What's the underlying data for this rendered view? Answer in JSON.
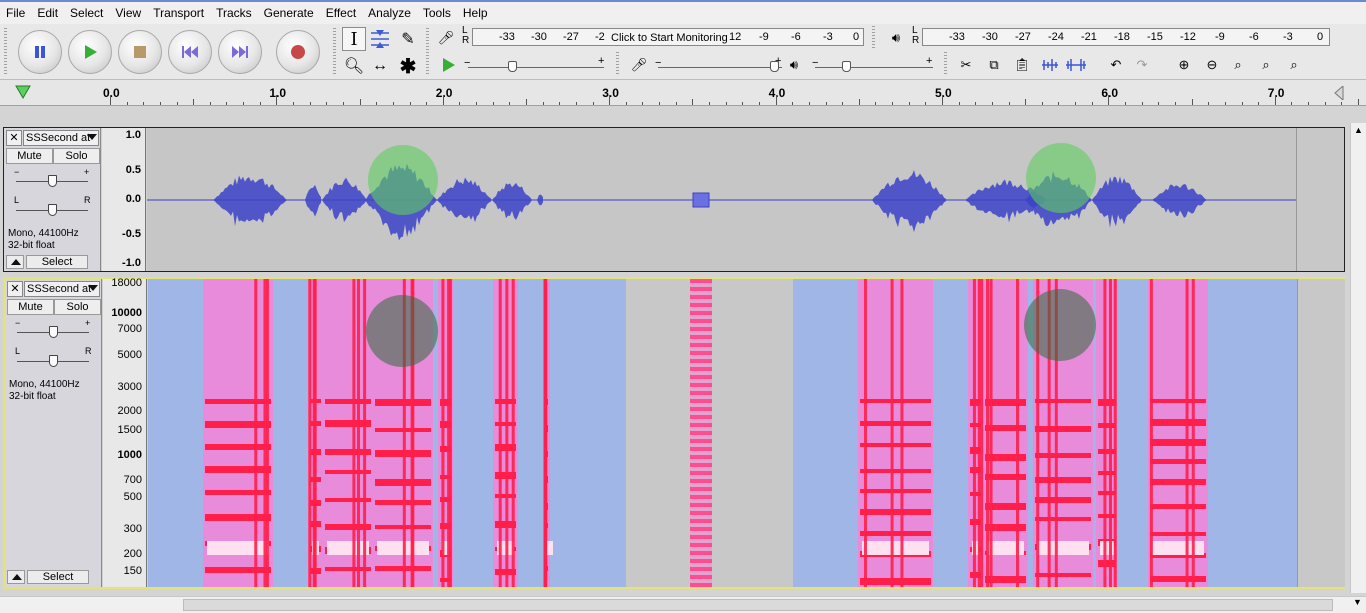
{
  "menu": [
    "File",
    "Edit",
    "Select",
    "View",
    "Transport",
    "Tracks",
    "Generate",
    "Effect",
    "Analyze",
    "Tools",
    "Help"
  ],
  "meters": {
    "record_scale": [
      "-33",
      "-30",
      "-27",
      "-2",
      "12",
      "-9",
      "-6",
      "-3",
      "0"
    ],
    "record_prompt": "Click to Start Monitoring",
    "play_scale": [
      "-33",
      "-30",
      "-27",
      "-24",
      "-21",
      "-18",
      "-15",
      "-12",
      "-9",
      "-6",
      "-3",
      "0"
    ],
    "record_lr": [
      "L",
      "R"
    ],
    "play_lr": [
      "L",
      "R"
    ]
  },
  "timeline": {
    "labels": [
      "0.0",
      "1.0",
      "2.0",
      "3.0",
      "4.0",
      "5.0",
      "6.0",
      "7.0"
    ]
  },
  "tracks": [
    {
      "name": "SSSecond at",
      "mute": "Mute",
      "solo": "Solo",
      "info_line1": "Mono, 44100Hz",
      "info_line2": "32-bit float",
      "select": "Select",
      "gain_minus": "−",
      "gain_plus": "+",
      "pan_l": "L",
      "pan_r": "R",
      "view": "waveform",
      "scale": [
        "1.0",
        "0.5",
        "0.0",
        "-0.5",
        "-1.0"
      ]
    },
    {
      "name": "SSSecond at",
      "mute": "Mute",
      "solo": "Solo",
      "info_line1": "Mono, 44100Hz",
      "info_line2": "32-bit float",
      "select": "Select",
      "gain_minus": "−",
      "gain_plus": "+",
      "pan_l": "L",
      "pan_r": "R",
      "view": "spectrogram",
      "scale": [
        "18000",
        "10000",
        "7000",
        "5000",
        "3000",
        "2000",
        "1500",
        "1000",
        "700",
        "500",
        "300",
        "200",
        "150"
      ]
    }
  ],
  "colors": {
    "waveform": "#3b42c8",
    "waveform_light": "#6a70e0",
    "highlight": "#5fcf5f",
    "spectro_high": "#ff1f4a",
    "spectro_mid": "#ff7cd6",
    "spectro_low": "#7fa8ff"
  }
}
